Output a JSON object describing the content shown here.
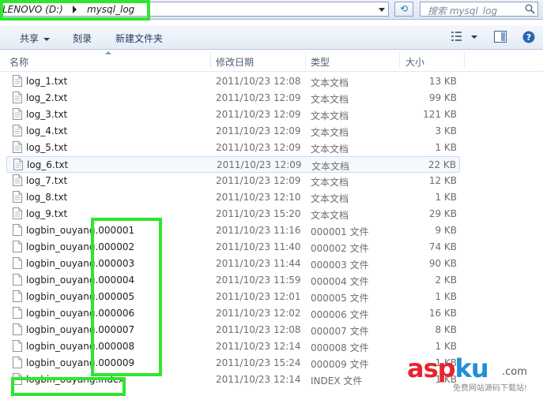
{
  "address": {
    "path_text": "LENOVO (D:)",
    "folder": "mysql_log"
  },
  "search": {
    "placeholder": "搜索 mysql_log"
  },
  "toolbar": {
    "share": "共享",
    "burn": "刻录",
    "new_folder": "新建文件夹"
  },
  "columns": {
    "name": "名称",
    "date": "修改日期",
    "type": "类型",
    "size": "大小"
  },
  "files": [
    {
      "name": "log_1.txt",
      "date": "2011/10/23 12:08",
      "type": "文本文档",
      "size": "13 KB"
    },
    {
      "name": "log_2.txt",
      "date": "2011/10/23 12:09",
      "type": "文本文档",
      "size": "99 KB"
    },
    {
      "name": "log_3.txt",
      "date": "2011/10/23 12:09",
      "type": "文本文档",
      "size": "121 KB"
    },
    {
      "name": "log_4.txt",
      "date": "2011/10/23 12:09",
      "type": "文本文档",
      "size": "3 KB"
    },
    {
      "name": "log_5.txt",
      "date": "2011/10/23 12:09",
      "type": "文本文档",
      "size": "1 KB"
    },
    {
      "name": "log_6.txt",
      "date": "2011/10/23 12:09",
      "type": "文本文档",
      "size": "22 KB"
    },
    {
      "name": "log_7.txt",
      "date": "2011/10/23 12:09",
      "type": "文本文档",
      "size": "12 KB"
    },
    {
      "name": "log_8.txt",
      "date": "2011/10/23 12:10",
      "type": "文本文档",
      "size": "1 KB"
    },
    {
      "name": "log_9.txt",
      "date": "2011/10/23 15:20",
      "type": "文本文档",
      "size": "29 KB"
    },
    {
      "name": "logbin_ouyang.000001",
      "date": "2011/10/23 11:16",
      "type": "000001 文件",
      "size": "9 KB"
    },
    {
      "name": "logbin_ouyang.000002",
      "date": "2011/10/23 11:40",
      "type": "000002 文件",
      "size": "74 KB"
    },
    {
      "name": "logbin_ouyang.000003",
      "date": "2011/10/23 11:44",
      "type": "000003 文件",
      "size": "90 KB"
    },
    {
      "name": "logbin_ouyang.000004",
      "date": "2011/10/23 11:59",
      "type": "000004 文件",
      "size": "2 KB"
    },
    {
      "name": "logbin_ouyang.000005",
      "date": "2011/10/23 12:01",
      "type": "000005 文件",
      "size": "1 KB"
    },
    {
      "name": "logbin_ouyang.000006",
      "date": "2011/10/23 12:02",
      "type": "000006 文件",
      "size": "16 KB"
    },
    {
      "name": "logbin_ouyang.000007",
      "date": "2011/10/23 12:08",
      "type": "000007 文件",
      "size": "8 KB"
    },
    {
      "name": "logbin_ouyang.000008",
      "date": "2011/10/23 12:14",
      "type": "000008 文件",
      "size": "1 KB"
    },
    {
      "name": "logbin_ouyang.000009",
      "date": "2011/10/23 15:24",
      "type": "000009 文件",
      "size": "1 KB"
    },
    {
      "name": "logbin_ouyang.index",
      "date": "2011/10/23 12:14",
      "type": "INDEX 文件",
      "size": "1 KB"
    }
  ],
  "selected_index": 5,
  "watermark": {
    "main_asp": "asp",
    "main_ku": "ku",
    "com": ".com",
    "sub": "免费网站源码下载站!"
  }
}
